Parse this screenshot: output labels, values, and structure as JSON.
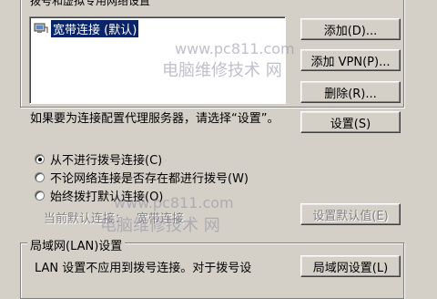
{
  "dialup": {
    "group_label": "拨号和虚拟专用网络设置",
    "connections": [
      {
        "label": "宽带连接 (默认)",
        "selected": true
      }
    ],
    "buttons": {
      "add": "添加(D)...",
      "add_vpn": "添加 VPN(P)...",
      "remove": "删除(R)..."
    }
  },
  "proxy": {
    "hint": "如果要为连接配置代理服务器，请选择“设置”。",
    "settings_button": "设置(S)"
  },
  "dial_options": [
    {
      "label": "从不进行拨号连接(C)",
      "checked": true
    },
    {
      "label": "不论网络连接是否存在都进行拨号(W)",
      "checked": false
    },
    {
      "label": "始终拨打默认连接(O)",
      "checked": false
    }
  ],
  "current_default": {
    "label": "当前默认连接：",
    "value": "宽带连接",
    "set_default_button": "设置默认值(E)"
  },
  "lan": {
    "group_label": "局域网(LAN)设置",
    "description": "LAN 设置不应用到拨号连接。对于拨号设",
    "button": "局域网设置(L)"
  },
  "watermarks": {
    "url": "www.pc811.com",
    "name": "电脑维修技术 网"
  },
  "colors": {
    "dialog_bg": "#d4d0c8",
    "selection": "#0a246a",
    "watermark": "#8c8ca0"
  }
}
